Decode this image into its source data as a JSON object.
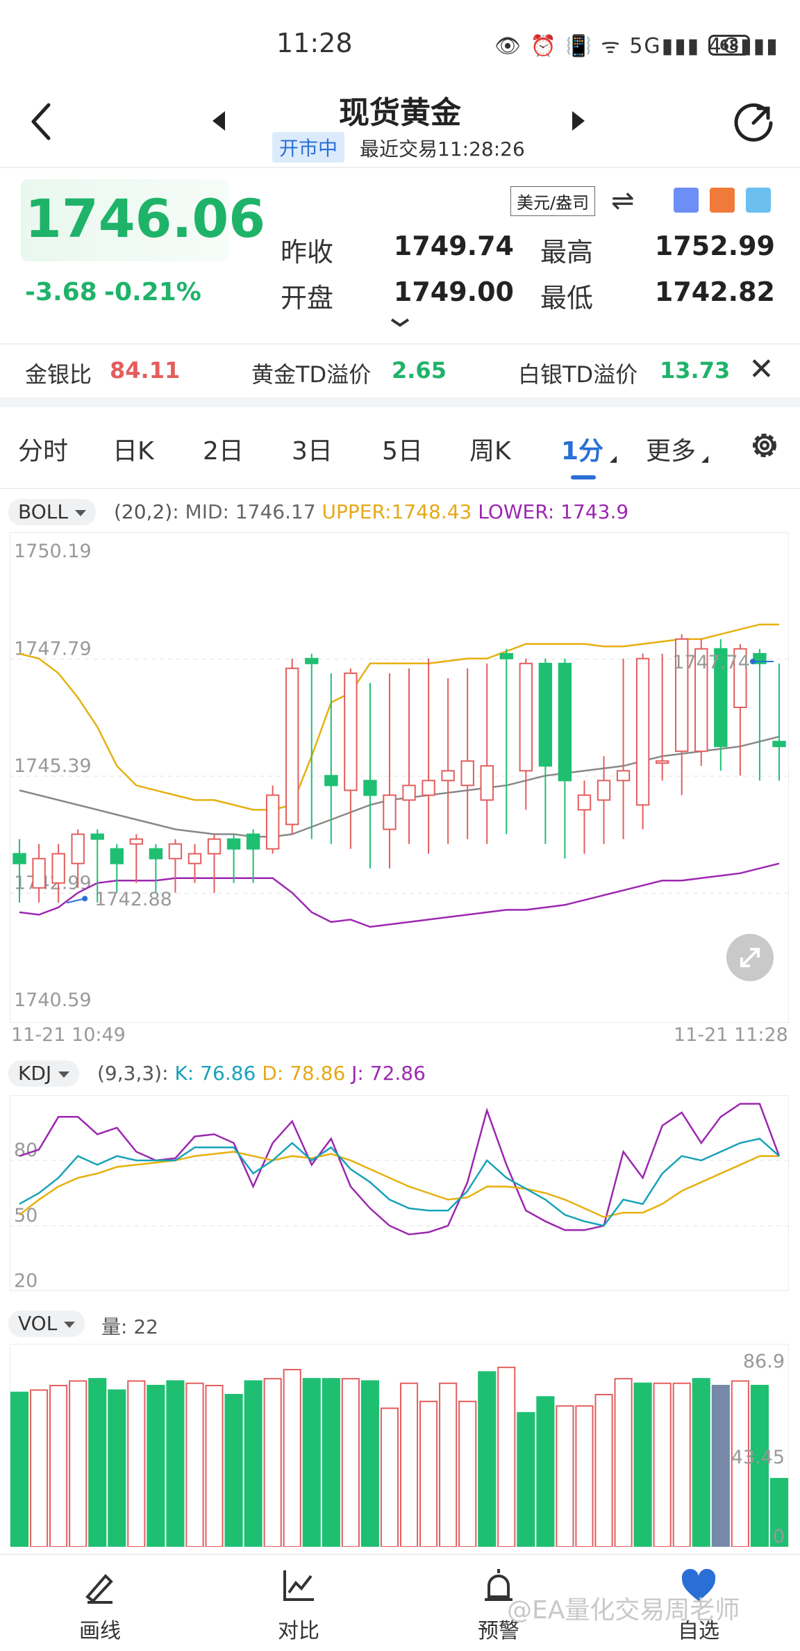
{
  "status_bar": {
    "time": "11:28",
    "icons": "👁 ⏰ 📳 ᯤ 5G▮▮▮ 4G▮▮▮",
    "battery": "68"
  },
  "header": {
    "title": "现货黄金",
    "market_status": "开市中",
    "last_trade": "最近交易11:28:26"
  },
  "quote": {
    "price": "1746.06",
    "change": "-3.68",
    "change_pct": "-0.21%",
    "unit": "美元/盎司",
    "prev_close_label": "昨收",
    "prev_close": "1749.74",
    "high_label": "最高",
    "high": "1752.99",
    "open_label": "开盘",
    "open": "1749.00",
    "low_label": "最低",
    "low": "1742.82"
  },
  "ratios": {
    "gold_silver_label": "金银比",
    "gold_silver": "84.11",
    "gold_td_label": "黄金TD溢价",
    "gold_td": "2.65",
    "silver_td_label": "白银TD溢价",
    "silver_td": "13.73"
  },
  "tabs": [
    {
      "label": "分时"
    },
    {
      "label": "日K"
    },
    {
      "label": "2日"
    },
    {
      "label": "3日"
    },
    {
      "label": "5日"
    },
    {
      "label": "周K"
    },
    {
      "label": "1分"
    },
    {
      "label": "更多"
    }
  ],
  "boll": {
    "chip": "BOLL",
    "params": "(20,2):",
    "mid": "MID: 1746.17",
    "upper": "UPPER:1748.43",
    "lower": "LOWER: 1743.9"
  },
  "kdj": {
    "chip": "KDJ",
    "params": "(9,3,3):",
    "k": "K: 76.86",
    "d": "D: 78.86",
    "j": "J: 72.86"
  },
  "vol": {
    "chip": "VOL",
    "text": "量: 22"
  },
  "price_axis": {
    "labels": [
      "1750.19",
      "1747.79",
      "1745.39",
      "1742.99",
      "1740.59"
    ],
    "high_mark": "1747.74",
    "low_mark": "1742.88"
  },
  "time_axis": {
    "start": "11-21 10:49",
    "end": "11-21 11:28"
  },
  "kdj_axis": {
    "labels": [
      "80",
      "50",
      "20"
    ]
  },
  "vol_axis": {
    "labels": [
      "86.9",
      "43.45",
      "0"
    ]
  },
  "colors": {
    "up": "#e35d5d",
    "down": "#1fbf72",
    "accent": "#2a6fd6",
    "upper": "#e6b00f",
    "lower": "#9c27b0",
    "mid": "#888888"
  },
  "chart_data": {
    "type": "candlestick",
    "ylim": [
      1740.59,
      1750.19
    ],
    "candles": [
      {
        "o": 1743.8,
        "c": 1743.6,
        "h": 1744.1,
        "l": 1742.8
      },
      {
        "o": 1743.1,
        "c": 1743.7,
        "h": 1744.0,
        "l": 1742.8
      },
      {
        "o": 1743.2,
        "c": 1743.8,
        "h": 1744.0,
        "l": 1742.8
      },
      {
        "o": 1743.6,
        "c": 1744.2,
        "h": 1744.3,
        "l": 1743.1
      },
      {
        "o": 1744.2,
        "c": 1744.1,
        "h": 1744.3,
        "l": 1742.8
      },
      {
        "o": 1743.9,
        "c": 1743.6,
        "h": 1744.0,
        "l": 1743.0
      },
      {
        "o": 1744.0,
        "c": 1744.1,
        "h": 1744.2,
        "l": 1743.2
      },
      {
        "o": 1743.9,
        "c": 1743.7,
        "h": 1744.0,
        "l": 1743.0
      },
      {
        "o": 1743.7,
        "c": 1744.0,
        "h": 1744.1,
        "l": 1743.0
      },
      {
        "o": 1743.6,
        "c": 1743.8,
        "h": 1744.0,
        "l": 1743.2
      },
      {
        "o": 1743.8,
        "c": 1744.1,
        "h": 1744.2,
        "l": 1743.0
      },
      {
        "o": 1744.1,
        "c": 1743.9,
        "h": 1744.2,
        "l": 1743.2
      },
      {
        "o": 1744.2,
        "c": 1743.9,
        "h": 1744.3,
        "l": 1743.2
      },
      {
        "o": 1743.9,
        "c": 1745.0,
        "h": 1745.2,
        "l": 1743.8
      },
      {
        "o": 1744.4,
        "c": 1747.6,
        "h": 1747.8,
        "l": 1744.2
      },
      {
        "o": 1747.8,
        "c": 1747.7,
        "h": 1747.9,
        "l": 1744.1
      },
      {
        "o": 1745.4,
        "c": 1745.2,
        "h": 1747.5,
        "l": 1744.0
      },
      {
        "o": 1745.1,
        "c": 1747.5,
        "h": 1747.6,
        "l": 1743.9
      },
      {
        "o": 1745.3,
        "c": 1745.0,
        "h": 1747.3,
        "l": 1743.5
      },
      {
        "o": 1744.3,
        "c": 1745.0,
        "h": 1747.5,
        "l": 1743.5
      },
      {
        "o": 1744.9,
        "c": 1745.2,
        "h": 1747.6,
        "l": 1744.0
      },
      {
        "o": 1745.0,
        "c": 1745.3,
        "h": 1747.8,
        "l": 1743.8
      },
      {
        "o": 1745.3,
        "c": 1745.5,
        "h": 1747.4,
        "l": 1744.0
      },
      {
        "o": 1745.2,
        "c": 1745.7,
        "h": 1747.6,
        "l": 1744.1
      },
      {
        "o": 1744.9,
        "c": 1745.6,
        "h": 1747.7,
        "l": 1744.0
      },
      {
        "o": 1747.9,
        "c": 1747.8,
        "h": 1748.0,
        "l": 1744.2
      },
      {
        "o": 1745.5,
        "c": 1747.7,
        "h": 1747.8,
        "l": 1744.7
      },
      {
        "o": 1747.7,
        "c": 1745.6,
        "h": 1747.8,
        "l": 1744.0
      },
      {
        "o": 1747.7,
        "c": 1745.3,
        "h": 1747.8,
        "l": 1743.7
      },
      {
        "o": 1744.7,
        "c": 1745.0,
        "h": 1745.3,
        "l": 1743.8
      },
      {
        "o": 1744.9,
        "c": 1745.3,
        "h": 1745.8,
        "l": 1744.0
      },
      {
        "o": 1745.3,
        "c": 1745.5,
        "h": 1747.8,
        "l": 1744.1
      },
      {
        "o": 1744.8,
        "c": 1747.8,
        "h": 1747.9,
        "l": 1744.3
      },
      {
        "o": 1745.7,
        "c": 1745.7,
        "h": 1747.9,
        "l": 1745.3
      },
      {
        "o": 1745.9,
        "c": 1748.2,
        "h": 1748.3,
        "l": 1745.0
      },
      {
        "o": 1745.9,
        "c": 1748.0,
        "h": 1748.2,
        "l": 1745.6
      },
      {
        "o": 1748.0,
        "c": 1746.0,
        "h": 1748.2,
        "l": 1745.5
      },
      {
        "o": 1746.8,
        "c": 1748.0,
        "h": 1748.1,
        "l": 1745.4
      },
      {
        "o": 1747.9,
        "c": 1747.7,
        "h": 1748.0,
        "l": 1745.3
      },
      {
        "o": 1746.1,
        "c": 1746.0,
        "h": 1747.7,
        "l": 1745.3
      }
    ],
    "boll_upper": [
      1747.9,
      1747.8,
      1747.5,
      1747.0,
      1746.4,
      1745.6,
      1745.2,
      1745.1,
      1745.0,
      1744.9,
      1744.9,
      1744.8,
      1744.7,
      1744.7,
      1744.8,
      1745.8,
      1746.9,
      1747.1,
      1747.7,
      1747.7,
      1747.7,
      1747.7,
      1747.75,
      1747.8,
      1747.8,
      1747.95,
      1748.1,
      1748.1,
      1748.1,
      1748.1,
      1748.05,
      1748.05,
      1748.1,
      1748.15,
      1748.2,
      1748.2,
      1748.3,
      1748.4,
      1748.5,
      1748.5
    ],
    "boll_mid": [
      1745.1,
      1745.0,
      1744.9,
      1744.8,
      1744.7,
      1744.6,
      1744.5,
      1744.4,
      1744.3,
      1744.25,
      1744.2,
      1744.2,
      1744.15,
      1744.15,
      1744.2,
      1744.35,
      1744.5,
      1744.65,
      1744.8,
      1744.9,
      1744.95,
      1745.0,
      1745.05,
      1745.1,
      1745.15,
      1745.2,
      1745.3,
      1745.4,
      1745.45,
      1745.5,
      1745.55,
      1745.6,
      1745.7,
      1745.8,
      1745.85,
      1745.9,
      1745.95,
      1746.0,
      1746.1,
      1746.2
    ],
    "boll_lower": [
      1742.6,
      1742.55,
      1742.7,
      1743.0,
      1743.2,
      1743.25,
      1743.25,
      1743.25,
      1743.3,
      1743.3,
      1743.3,
      1743.3,
      1743.3,
      1743.3,
      1743.0,
      1742.6,
      1742.4,
      1742.45,
      1742.3,
      1742.35,
      1742.4,
      1742.45,
      1742.5,
      1742.55,
      1742.6,
      1742.65,
      1742.65,
      1742.7,
      1742.75,
      1742.85,
      1742.95,
      1743.05,
      1743.15,
      1743.25,
      1743.25,
      1743.3,
      1743.35,
      1743.4,
      1743.5,
      1743.6
    ],
    "kdj_ylim": [
      20,
      110
    ],
    "k": [
      60,
      65,
      72,
      82,
      78,
      82,
      80,
      80,
      80,
      86,
      86,
      86,
      74,
      80,
      88,
      80,
      86,
      76,
      70,
      62,
      58,
      57,
      57,
      66,
      80,
      72,
      67,
      62,
      55,
      52,
      50,
      62,
      60,
      74,
      82,
      80,
      84,
      88,
      90,
      82
    ],
    "d": [
      55,
      62,
      68,
      72,
      74,
      77,
      78,
      79,
      80,
      82,
      83,
      84,
      82,
      80,
      82,
      81,
      83,
      80,
      76,
      72,
      68,
      65,
      62,
      63,
      68,
      68,
      67,
      65,
      62,
      58,
      54,
      56,
      56,
      60,
      66,
      70,
      74,
      78,
      82,
      82
    ],
    "j": [
      82,
      85,
      100,
      100,
      92,
      95,
      84,
      80,
      81,
      91,
      92,
      88,
      68,
      88,
      98,
      78,
      90,
      68,
      58,
      50,
      46,
      47,
      50,
      70,
      103,
      78,
      57,
      52,
      48,
      48,
      50,
      84,
      72,
      96,
      102,
      88,
      100,
      106,
      106,
      82
    ],
    "volume": [
      {
        "v": 68,
        "up": false
      },
      {
        "v": 69,
        "up": true
      },
      {
        "v": 71,
        "up": true
      },
      {
        "v": 73,
        "up": true
      },
      {
        "v": 74,
        "up": false
      },
      {
        "v": 69,
        "up": false
      },
      {
        "v": 73,
        "up": true
      },
      {
        "v": 71,
        "up": false
      },
      {
        "v": 73,
        "up": false
      },
      {
        "v": 72,
        "up": true
      },
      {
        "v": 71,
        "up": true
      },
      {
        "v": 67,
        "up": false
      },
      {
        "v": 73,
        "up": false
      },
      {
        "v": 74,
        "up": true
      },
      {
        "v": 78,
        "up": true
      },
      {
        "v": 74,
        "up": false
      },
      {
        "v": 74,
        "up": false
      },
      {
        "v": 74,
        "up": true
      },
      {
        "v": 73,
        "up": false
      },
      {
        "v": 61,
        "up": true
      },
      {
        "v": 72,
        "up": true
      },
      {
        "v": 64,
        "up": true
      },
      {
        "v": 72,
        "up": true
      },
      {
        "v": 64,
        "up": true
      },
      {
        "v": 77,
        "up": false
      },
      {
        "v": 79,
        "up": true
      },
      {
        "v": 59,
        "up": false
      },
      {
        "v": 66,
        "up": false
      },
      {
        "v": 62,
        "up": true
      },
      {
        "v": 62,
        "up": true
      },
      {
        "v": 67,
        "up": true
      },
      {
        "v": 74,
        "up": true
      },
      {
        "v": 72,
        "up": false
      },
      {
        "v": 72,
        "up": true
      },
      {
        "v": 72,
        "up": true
      },
      {
        "v": 74,
        "up": false
      },
      {
        "v": 71,
        "up": false
      },
      {
        "v": 73,
        "up": true
      },
      {
        "v": 71,
        "up": false
      },
      {
        "v": 30,
        "up": false
      }
    ],
    "vol_ylim": [
      0,
      86.9
    ]
  },
  "bottom_nav": [
    {
      "label": "画线"
    },
    {
      "label": "对比"
    },
    {
      "label": "预警"
    },
    {
      "label": "自选"
    }
  ],
  "watermark": "@EA量化交易周老师"
}
